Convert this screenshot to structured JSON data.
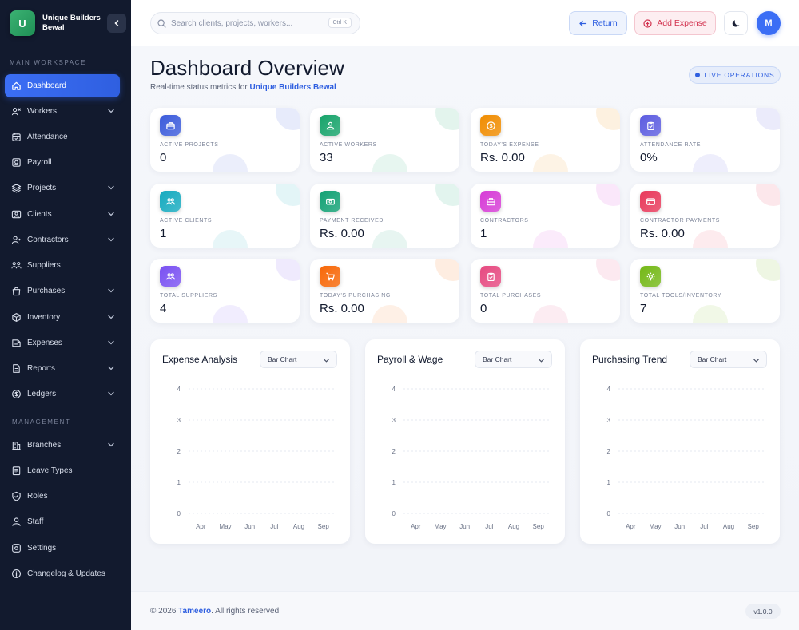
{
  "brand": {
    "initial": "U",
    "name": "Unique Builders Bewal"
  },
  "sidebar": {
    "sections": [
      {
        "label": "MAIN WORKSPACE"
      },
      {
        "label": "MANAGEMENT"
      }
    ],
    "items": [
      {
        "label": "Dashboard",
        "icon": "home-icon"
      },
      {
        "label": "Workers",
        "icon": "workers-icon"
      },
      {
        "label": "Attendance",
        "icon": "calendar-icon"
      },
      {
        "label": "Payroll",
        "icon": "payroll-icon"
      },
      {
        "label": "Projects",
        "icon": "layers-icon"
      },
      {
        "label": "Clients",
        "icon": "clients-icon"
      },
      {
        "label": "Contractors",
        "icon": "contractor-icon"
      },
      {
        "label": "Suppliers",
        "icon": "suppliers-icon"
      },
      {
        "label": "Purchases",
        "icon": "bag-icon"
      },
      {
        "label": "Inventory",
        "icon": "box-icon"
      },
      {
        "label": "Expenses",
        "icon": "expense-icon"
      },
      {
        "label": "Reports",
        "icon": "report-icon"
      },
      {
        "label": "Ledgers",
        "icon": "ledger-icon"
      },
      {
        "label": "Branches",
        "icon": "building-icon"
      },
      {
        "label": "Leave Types",
        "icon": "leave-icon"
      },
      {
        "label": "Roles",
        "icon": "shield-icon"
      },
      {
        "label": "Staff",
        "icon": "staff-icon"
      },
      {
        "label": "Settings",
        "icon": "settings-icon"
      },
      {
        "label": "Changelog & Updates",
        "icon": "info-icon"
      }
    ]
  },
  "topbar": {
    "search_placeholder": "Search clients, projects, workers...",
    "shortcut": "Ctrl K",
    "return_label": "Return",
    "add_expense_label": "Add Expense",
    "avatar_initial": "M"
  },
  "header": {
    "title": "Dashboard Overview",
    "subtitle_prefix": "Real-time status metrics for",
    "subtitle_company": "Unique Builders Bewal",
    "live_badge": "LIVE OPERATIONS"
  },
  "stats": [
    {
      "label": "ACTIVE PROJECTS",
      "value": "0",
      "color": "#3b5bdb",
      "icon": "briefcase-icon"
    },
    {
      "label": "ACTIVE WORKERS",
      "value": "33",
      "color": "#16a36a",
      "icon": "worker-icon"
    },
    {
      "label": "TODAY'S EXPENSE",
      "value": "Rs. 0.00",
      "color": "#f08c00",
      "icon": "coin-icon"
    },
    {
      "label": "ATTENDANCE RATE",
      "value": "0%",
      "color": "#5c5ce0",
      "icon": "clipboard-icon"
    },
    {
      "label": "ACTIVE CLIENTS",
      "value": "1",
      "color": "#15aabf",
      "icon": "users-icon"
    },
    {
      "label": "PAYMENT RECEIVED",
      "value": "Rs. 0.00",
      "color": "#12a174",
      "icon": "cash-icon"
    },
    {
      "label": "CONTRACTORS",
      "value": "1",
      "color": "#d63bd6",
      "icon": "briefcase-icon"
    },
    {
      "label": "CONTRACTOR PAYMENTS",
      "value": "Rs. 0.00",
      "color": "#e8385a",
      "icon": "card-icon"
    },
    {
      "label": "TOTAL SUPPLIERS",
      "value": "4",
      "color": "#7950f2",
      "icon": "users-icon"
    },
    {
      "label": "TODAY'S PURCHASING",
      "value": "Rs. 0.00",
      "color": "#f76707",
      "icon": "cart-icon"
    },
    {
      "label": "TOTAL PURCHASES",
      "value": "0",
      "color": "#e64980",
      "icon": "clipboard-icon"
    },
    {
      "label": "TOTAL TOOLS/INVENTORY",
      "value": "7",
      "color": "#74b816",
      "icon": "gear-icon"
    }
  ],
  "charts_ui": [
    {
      "title": "Expense Analysis",
      "select": "Bar Chart"
    },
    {
      "title": "Payroll & Wage",
      "select": "Bar Chart"
    },
    {
      "title": "Purchasing Trend",
      "select": "Bar Chart"
    }
  ],
  "chart_data": [
    {
      "type": "bar",
      "categories": [
        "Apr",
        "May",
        "Jun",
        "Jul",
        "Aug",
        "Sep"
      ],
      "values": [
        0,
        0,
        0,
        0,
        0,
        0
      ],
      "yticks": [
        "0",
        "1",
        "2",
        "3",
        "4"
      ],
      "ylim": [
        0,
        4
      ],
      "grid": true
    },
    {
      "type": "bar",
      "categories": [
        "Apr",
        "May",
        "Jun",
        "Jul",
        "Aug",
        "Sep"
      ],
      "values": [
        0,
        0,
        0,
        0,
        0,
        0
      ],
      "yticks": [
        "0",
        "1",
        "2",
        "3",
        "4"
      ],
      "ylim": [
        0,
        4
      ],
      "grid": true
    },
    {
      "type": "bar",
      "categories": [
        "Apr",
        "May",
        "Jun",
        "Jul",
        "Aug",
        "Sep"
      ],
      "values": [
        0,
        0,
        0,
        0,
        0,
        0
      ],
      "yticks": [
        "0",
        "1",
        "2",
        "3",
        "4"
      ],
      "ylim": [
        0,
        4
      ],
      "grid": true
    }
  ],
  "footer": {
    "copyright": "© 2026",
    "company": "Tameero",
    "rights": ". All rights reserved.",
    "version": "v1.0.0"
  }
}
